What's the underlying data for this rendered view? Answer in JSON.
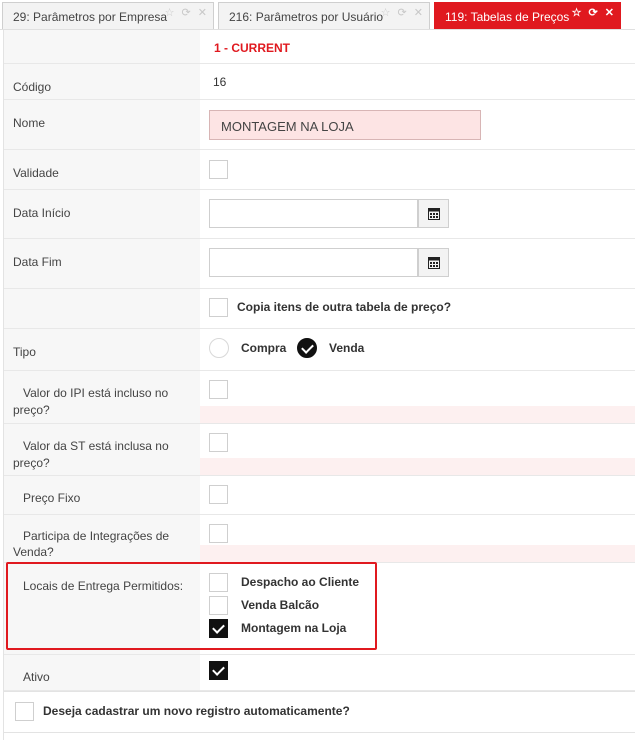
{
  "tabs": [
    {
      "label": "29: Parâmetros por Empresa",
      "icons": "☆ ⟳ ✕"
    },
    {
      "label": "216: Parâmetros por Usuário",
      "icons": "☆ ⟳ ✕"
    },
    {
      "label": "119: Tabelas de Preços",
      "icons": "☆ ⟳ ✕"
    }
  ],
  "colors": {
    "accent": "#e0191f",
    "name_field_bg": "#fde4e4"
  },
  "form": {
    "status": "1 - CURRENT",
    "codigo_label": "Código",
    "codigo_value": "16",
    "nome_label": "Nome",
    "nome_value": "MONTAGEM NA LOJA",
    "validade_label": "Validade",
    "data_inicio_label": "Data Início",
    "data_inicio_value": "",
    "data_fim_label": "Data Fim",
    "data_fim_value": "",
    "copia_label": "Copia itens de outra tabela de preço?",
    "tipo_label": "Tipo",
    "tipo_options": [
      "Compra",
      "Venda"
    ],
    "tipo_selected": "Venda",
    "ipi_label": "Valor do IPI está incluso no",
    "ipi_label2": "preço?",
    "st_label": "Valor da ST está inclusa no",
    "st_label2": "preço?",
    "preco_fixo_label": "Preço Fixo",
    "integracoes_label": "Participa de Integrações de",
    "integracoes_label2": "Venda?",
    "locais_label": "Locais de Entrega Permitidos:",
    "locais_options": [
      {
        "label": "Despacho ao Cliente",
        "checked": false
      },
      {
        "label": "Venda Balcão",
        "checked": false
      },
      {
        "label": "Montagem na Loja",
        "checked": true
      }
    ],
    "ativo_label": "Ativo",
    "ativo_checked": true,
    "auto_label": "Deseja cadastrar um novo registro automaticamente?"
  }
}
